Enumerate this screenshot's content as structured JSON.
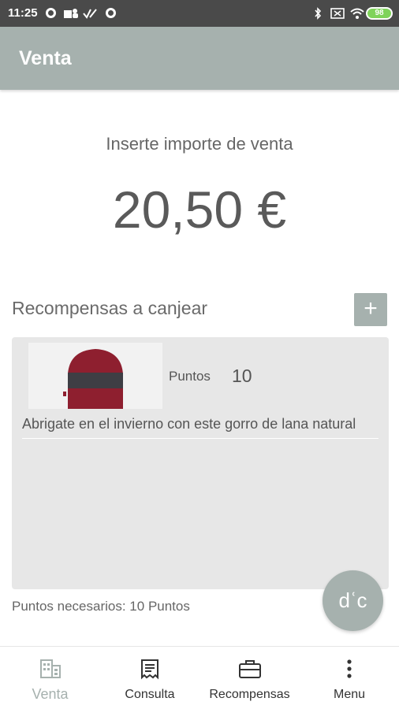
{
  "status_bar": {
    "time": "11:25",
    "battery": "98"
  },
  "app_bar": {
    "title": "Venta"
  },
  "sale": {
    "prompt": "Inserte importe de venta",
    "amount": "20,50 €"
  },
  "rewards": {
    "section_title": "Recompensas a canjear",
    "add_label": "+",
    "items": [
      {
        "points_label": "Puntos",
        "points_value": "10",
        "description": "Abrigate en el invierno con este gorro de lana natural",
        "image_icon": "wool-hat-image"
      }
    ],
    "required_text": "Puntos necesarios: 10 Puntos"
  },
  "fab": {
    "label": "dʿc"
  },
  "bottom_nav": {
    "items": [
      {
        "label": "Venta",
        "icon": "building-icon",
        "active": true
      },
      {
        "label": "Consulta",
        "icon": "receipt-icon",
        "active": false
      },
      {
        "label": "Recompensas",
        "icon": "briefcase-icon",
        "active": false
      },
      {
        "label": "Menu",
        "icon": "more-vert-icon",
        "active": false
      }
    ]
  },
  "colors": {
    "accent": "#a6b1ae",
    "status_bar": "#4a4a4a",
    "card_bg": "#e7e7e7",
    "battery": "#7fd35a"
  }
}
